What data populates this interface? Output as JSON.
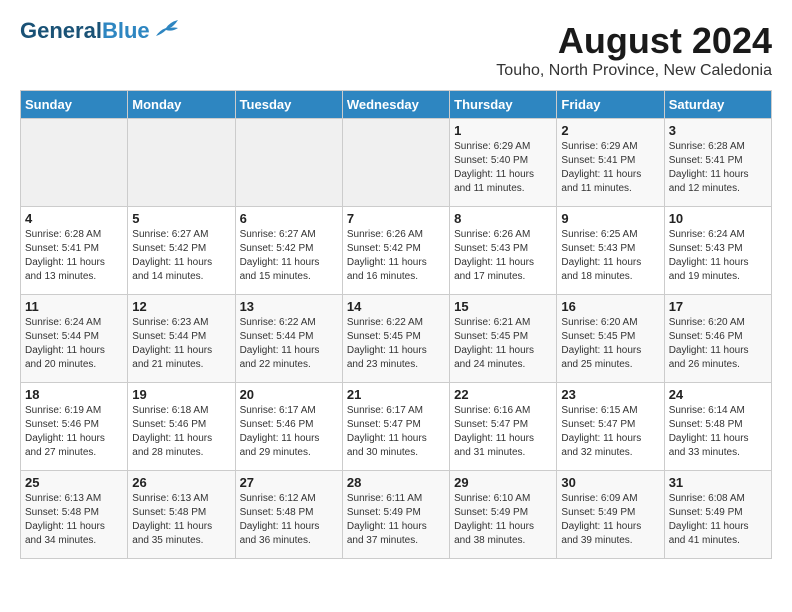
{
  "header": {
    "logo_line1": "General",
    "logo_line2": "Blue",
    "month_year": "August 2024",
    "location": "Touho, North Province, New Caledonia"
  },
  "weekdays": [
    "Sunday",
    "Monday",
    "Tuesday",
    "Wednesday",
    "Thursday",
    "Friday",
    "Saturday"
  ],
  "weeks": [
    [
      {
        "day": "",
        "empty": true
      },
      {
        "day": "",
        "empty": true
      },
      {
        "day": "",
        "empty": true
      },
      {
        "day": "",
        "empty": true
      },
      {
        "day": "1",
        "sunrise": "6:29 AM",
        "sunset": "5:40 PM",
        "daylight": "11 hours and 11 minutes."
      },
      {
        "day": "2",
        "sunrise": "6:29 AM",
        "sunset": "5:41 PM",
        "daylight": "11 hours and 11 minutes."
      },
      {
        "day": "3",
        "sunrise": "6:28 AM",
        "sunset": "5:41 PM",
        "daylight": "11 hours and 12 minutes."
      }
    ],
    [
      {
        "day": "4",
        "sunrise": "6:28 AM",
        "sunset": "5:41 PM",
        "daylight": "11 hours and 13 minutes."
      },
      {
        "day": "5",
        "sunrise": "6:27 AM",
        "sunset": "5:42 PM",
        "daylight": "11 hours and 14 minutes."
      },
      {
        "day": "6",
        "sunrise": "6:27 AM",
        "sunset": "5:42 PM",
        "daylight": "11 hours and 15 minutes."
      },
      {
        "day": "7",
        "sunrise": "6:26 AM",
        "sunset": "5:42 PM",
        "daylight": "11 hours and 16 minutes."
      },
      {
        "day": "8",
        "sunrise": "6:26 AM",
        "sunset": "5:43 PM",
        "daylight": "11 hours and 17 minutes."
      },
      {
        "day": "9",
        "sunrise": "6:25 AM",
        "sunset": "5:43 PM",
        "daylight": "11 hours and 18 minutes."
      },
      {
        "day": "10",
        "sunrise": "6:24 AM",
        "sunset": "5:43 PM",
        "daylight": "11 hours and 19 minutes."
      }
    ],
    [
      {
        "day": "11",
        "sunrise": "6:24 AM",
        "sunset": "5:44 PM",
        "daylight": "11 hours and 20 minutes."
      },
      {
        "day": "12",
        "sunrise": "6:23 AM",
        "sunset": "5:44 PM",
        "daylight": "11 hours and 21 minutes."
      },
      {
        "day": "13",
        "sunrise": "6:22 AM",
        "sunset": "5:44 PM",
        "daylight": "11 hours and 22 minutes."
      },
      {
        "day": "14",
        "sunrise": "6:22 AM",
        "sunset": "5:45 PM",
        "daylight": "11 hours and 23 minutes."
      },
      {
        "day": "15",
        "sunrise": "6:21 AM",
        "sunset": "5:45 PM",
        "daylight": "11 hours and 24 minutes."
      },
      {
        "day": "16",
        "sunrise": "6:20 AM",
        "sunset": "5:45 PM",
        "daylight": "11 hours and 25 minutes."
      },
      {
        "day": "17",
        "sunrise": "6:20 AM",
        "sunset": "5:46 PM",
        "daylight": "11 hours and 26 minutes."
      }
    ],
    [
      {
        "day": "18",
        "sunrise": "6:19 AM",
        "sunset": "5:46 PM",
        "daylight": "11 hours and 27 minutes."
      },
      {
        "day": "19",
        "sunrise": "6:18 AM",
        "sunset": "5:46 PM",
        "daylight": "11 hours and 28 minutes."
      },
      {
        "day": "20",
        "sunrise": "6:17 AM",
        "sunset": "5:46 PM",
        "daylight": "11 hours and 29 minutes."
      },
      {
        "day": "21",
        "sunrise": "6:17 AM",
        "sunset": "5:47 PM",
        "daylight": "11 hours and 30 minutes."
      },
      {
        "day": "22",
        "sunrise": "6:16 AM",
        "sunset": "5:47 PM",
        "daylight": "11 hours and 31 minutes."
      },
      {
        "day": "23",
        "sunrise": "6:15 AM",
        "sunset": "5:47 PM",
        "daylight": "11 hours and 32 minutes."
      },
      {
        "day": "24",
        "sunrise": "6:14 AM",
        "sunset": "5:48 PM",
        "daylight": "11 hours and 33 minutes."
      }
    ],
    [
      {
        "day": "25",
        "sunrise": "6:13 AM",
        "sunset": "5:48 PM",
        "daylight": "11 hours and 34 minutes."
      },
      {
        "day": "26",
        "sunrise": "6:13 AM",
        "sunset": "5:48 PM",
        "daylight": "11 hours and 35 minutes."
      },
      {
        "day": "27",
        "sunrise": "6:12 AM",
        "sunset": "5:48 PM",
        "daylight": "11 hours and 36 minutes."
      },
      {
        "day": "28",
        "sunrise": "6:11 AM",
        "sunset": "5:49 PM",
        "daylight": "11 hours and 37 minutes."
      },
      {
        "day": "29",
        "sunrise": "6:10 AM",
        "sunset": "5:49 PM",
        "daylight": "11 hours and 38 minutes."
      },
      {
        "day": "30",
        "sunrise": "6:09 AM",
        "sunset": "5:49 PM",
        "daylight": "11 hours and 39 minutes."
      },
      {
        "day": "31",
        "sunrise": "6:08 AM",
        "sunset": "5:49 PM",
        "daylight": "11 hours and 41 minutes."
      }
    ]
  ],
  "labels": {
    "sunrise": "Sunrise:",
    "sunset": "Sunset:",
    "daylight": "Daylight:"
  }
}
